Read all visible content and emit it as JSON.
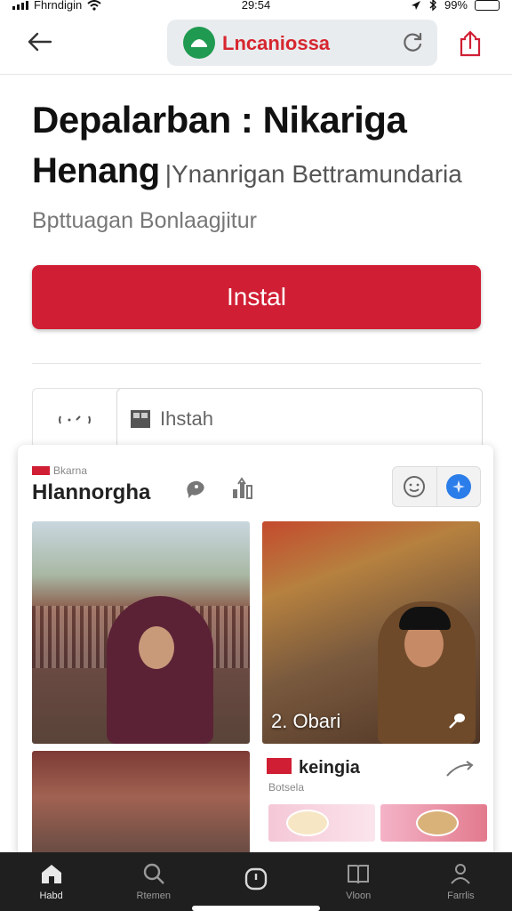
{
  "status_bar": {
    "carrier": "Fhrndigin",
    "time": "29:54",
    "battery": "99%",
    "battery_level": 0.99
  },
  "address_bar": {
    "url_text": "Lncaniossa"
  },
  "header": {
    "title": "Depalarban : Nikariga",
    "subtitle_main": "Henang",
    "subtitle_side": "|Ynanrigan Bettramundaria",
    "tagline": "Bpttuagan Bonlaagjitur"
  },
  "install_button": {
    "label": "Instal"
  },
  "secondary": {
    "field_label": "Ihstah"
  },
  "card": {
    "small_label": "Bkarna",
    "title": "Hlannorgha",
    "tile_b_caption": "2. Obari",
    "sub_card": {
      "title": "keingia",
      "meta": "Botsela"
    }
  },
  "tabs": [
    {
      "label": "Habd",
      "icon": "home-icon"
    },
    {
      "label": "Rtemen",
      "icon": "search-icon"
    },
    {
      "label": "",
      "icon": "clock-icon"
    },
    {
      "label": "Vloon",
      "icon": "book-icon"
    },
    {
      "label": "Farrlis",
      "icon": "profile-icon"
    }
  ],
  "colors": {
    "accent_red": "#d01f34",
    "brand_green": "#1f9a50",
    "tab_bar_bg": "#1f1f1f",
    "action_blue": "#2b7de9"
  }
}
